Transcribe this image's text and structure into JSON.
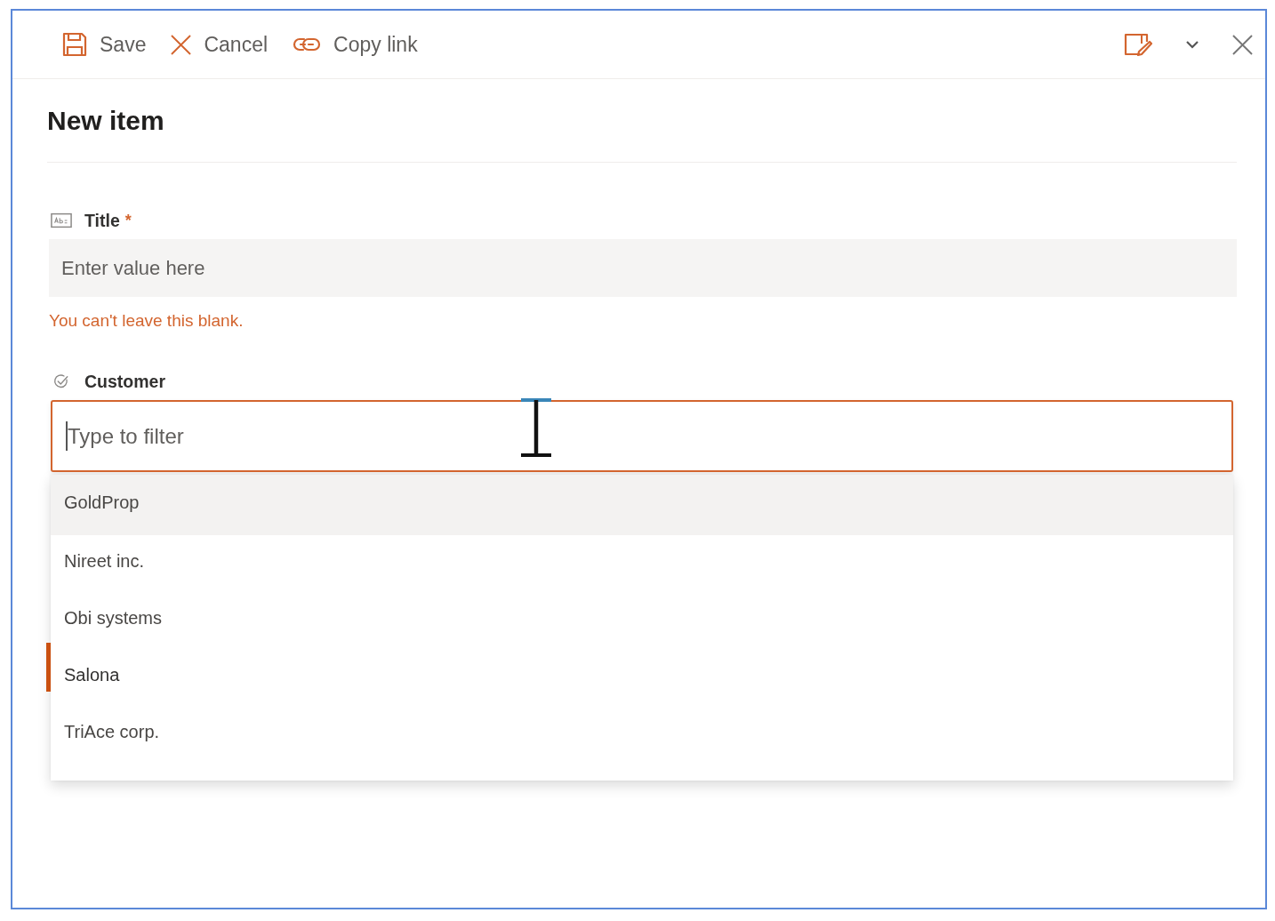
{
  "toolbar": {
    "actions": [
      {
        "kind": "save",
        "label": "Save"
      },
      {
        "kind": "cancel",
        "label": "Cancel"
      },
      {
        "kind": "copy_link",
        "label": "Copy link"
      }
    ]
  },
  "form": {
    "title": "New item",
    "fields": [
      {
        "kind": "text",
        "label": "Title",
        "required_mark": "*",
        "placeholder": "Enter value here",
        "focused": false,
        "error": "You can't leave this blank."
      },
      {
        "kind": "choice",
        "label": "Customer",
        "placeholder": "Type to filter",
        "focused": true,
        "expanded": true,
        "options": [
          {
            "label": "GoldProp",
            "hovered": true,
            "selected": false
          },
          {
            "label": "Nireet inc.",
            "hovered": false,
            "selected": false
          },
          {
            "label": "Obi systems",
            "hovered": false,
            "selected": false
          },
          {
            "label": "Salona",
            "hovered": false,
            "selected": true
          },
          {
            "label": "TriAce corp.",
            "hovered": false,
            "selected": false
          }
        ]
      }
    ]
  }
}
